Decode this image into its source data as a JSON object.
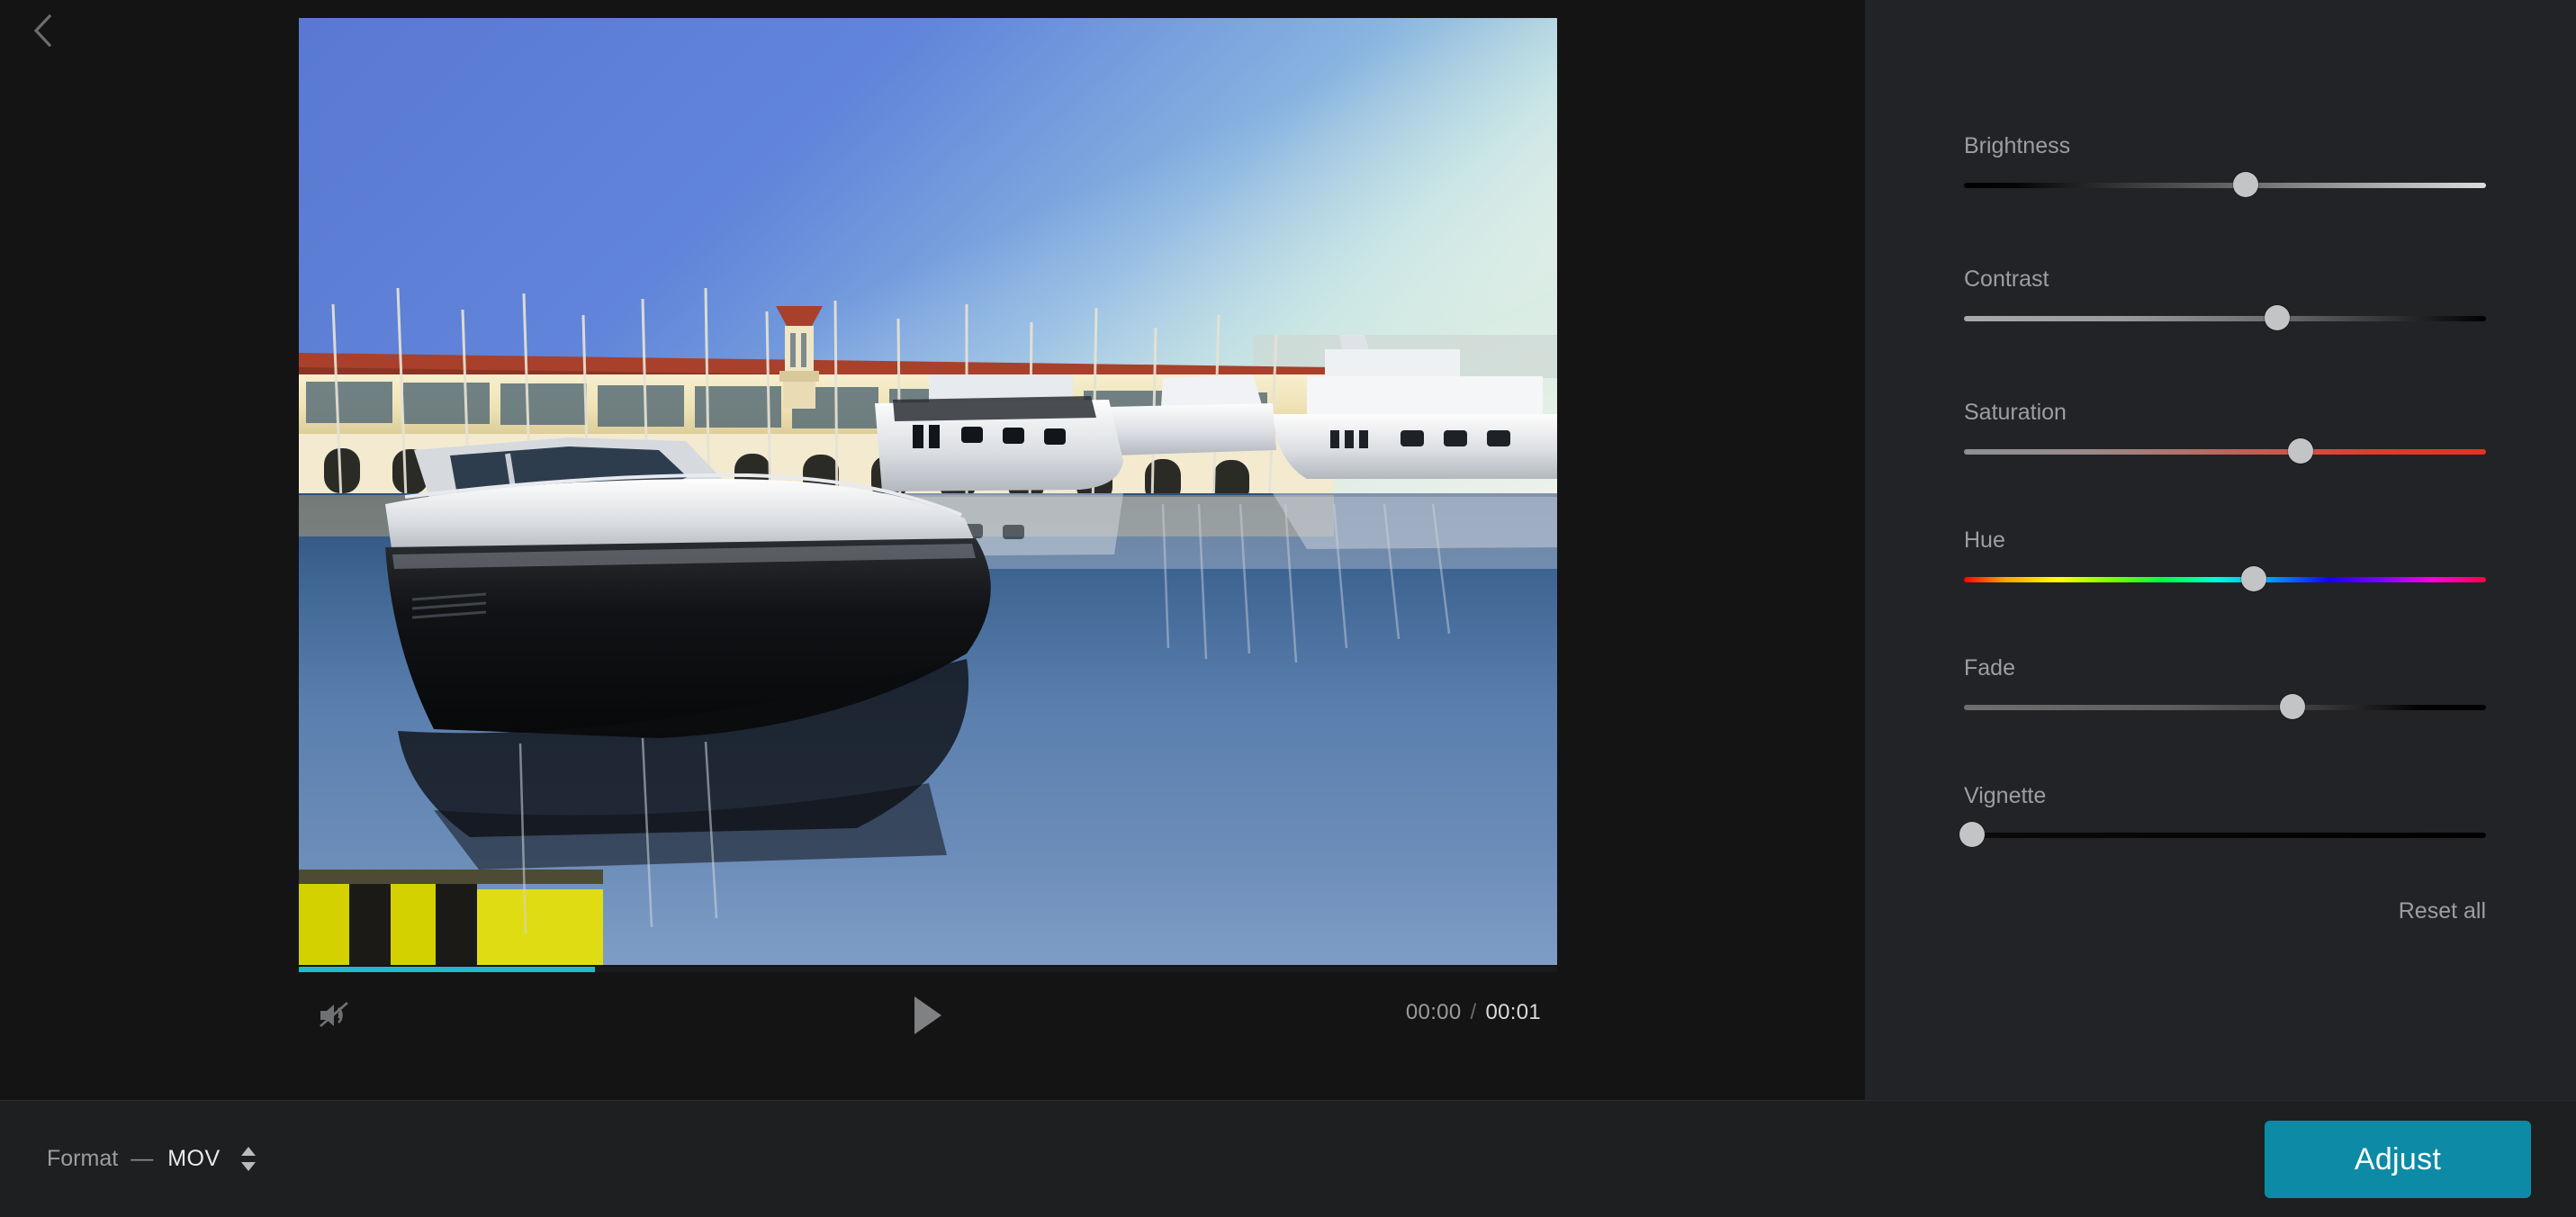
{
  "nav": {
    "back_icon": "chevron-left-icon"
  },
  "player": {
    "progress_percent": 23.5,
    "progress_color": "#25b7cf",
    "mute_icon": "speaker-muted-icon",
    "play_icon": "play-icon",
    "time_current": "00:00",
    "time_separator": "/",
    "time_total": "00:01",
    "video_description": "Marina at golden hour with a black-hulled motor yacht moored in the foreground, white yachts and sailboat masts beyond, a long cream building with a red tile roof and a clock tower, all mirrored in still blue water."
  },
  "bottom_bar": {
    "format_label": "Format",
    "format_dash": "—",
    "format_value": "MOV",
    "format_stepper_icon": "stepper-updown-icon",
    "adjust_label": "Adjust",
    "adjust_color": "#0d8ba6"
  },
  "adjust_panel": {
    "sliders": [
      {
        "label": "Brightness",
        "value_percent": 54,
        "track": "black-to-white"
      },
      {
        "label": "Contrast",
        "value_percent": 60,
        "track": "gray-to-black"
      },
      {
        "label": "Saturation",
        "value_percent": 64.5,
        "track": "gray-to-red"
      },
      {
        "label": "Hue",
        "value_percent": 55.5,
        "track": "rainbow-spectrum"
      },
      {
        "label": "Fade",
        "value_percent": 63,
        "track": "gray-to-black"
      },
      {
        "label": "Vignette",
        "value_percent": 1.5,
        "track": "black"
      }
    ],
    "reset_label": "Reset all"
  }
}
